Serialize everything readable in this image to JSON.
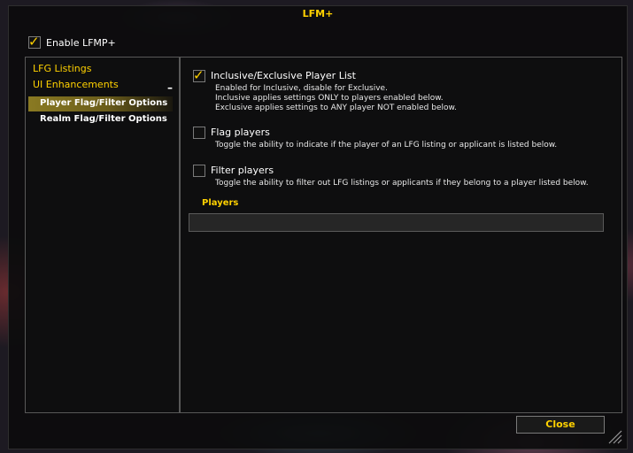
{
  "window": {
    "title": "LFM+"
  },
  "enable": {
    "label": "Enable LFMP+",
    "checked": true
  },
  "sidebar": {
    "items": [
      {
        "label": "LFG Listings"
      },
      {
        "label": "UI Enhancements",
        "toggle": "–"
      },
      {
        "label": "Player Flag/Filter Options",
        "selected": true
      },
      {
        "label": "Realm Flag/Filter Options"
      }
    ]
  },
  "options": {
    "inclusive": {
      "label": "Inclusive/Exclusive Player List",
      "checked": true,
      "desc1": "Enabled for Inclusive, disable for Exclusive.",
      "desc2": "Inclusive applies settings ONLY to players enabled below.",
      "desc3": "Exclusive applies settings to ANY player NOT enabled below."
    },
    "flag": {
      "label": "Flag players",
      "checked": false,
      "desc": "Toggle the ability to indicate if the player of an LFG listing or applicant is listed below."
    },
    "filter": {
      "label": "Filter players",
      "checked": false,
      "desc": "Toggle the ability to filter out LFG listings or applicants if they belong to a player listed below."
    }
  },
  "players": {
    "label": "Players",
    "value": ""
  },
  "footer": {
    "close_label": "Close"
  },
  "colors": {
    "accent": "#ffd100",
    "selected": "#8a7a22"
  }
}
